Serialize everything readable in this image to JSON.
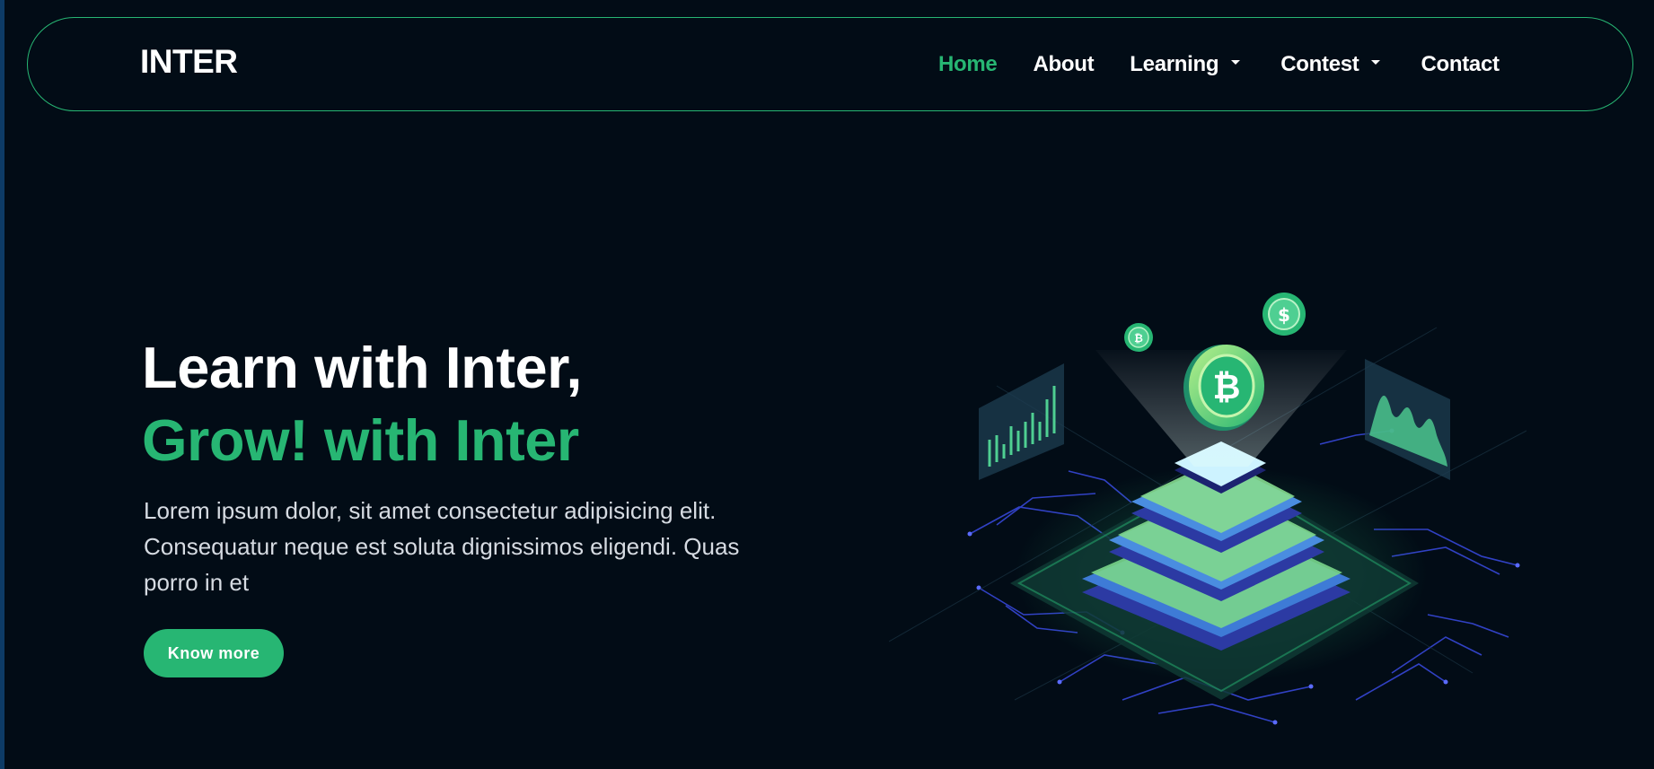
{
  "navbar": {
    "brand": "INTER",
    "links": [
      {
        "label": "Home",
        "active": true
      },
      {
        "label": "About",
        "active": false
      },
      {
        "label": "Learning",
        "dropdown": true
      },
      {
        "label": "Contest",
        "dropdown": true
      },
      {
        "label": "Contact",
        "active": false
      }
    ]
  },
  "hero": {
    "title_line1": "Learn with Inter,",
    "title_line2": "Grow! with Inter",
    "description": "Lorem ipsum dolor, sit amet consectetur adipisicing elit. Consequatur neque est soluta dignissimos eligendi. Quas porro in et",
    "cta_label": "Know more"
  },
  "illustration": {
    "icon": "crypto-mining-isometric",
    "coin_symbol": "₿"
  },
  "colors": {
    "background": "#020c16",
    "accent": "#27b673",
    "text": "#ffffff",
    "muted_text": "#d6dbe2",
    "circuit": "#3d4ff0"
  }
}
